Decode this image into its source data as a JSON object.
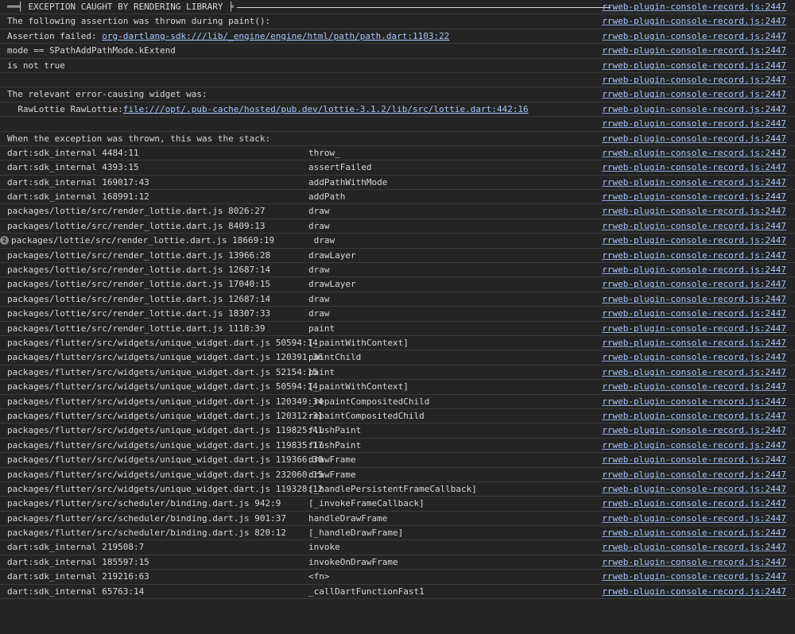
{
  "header_line": "══╡ EXCEPTION CAUGHT BY RENDERING LIBRARY ╞",
  "source_link": "rrweb-plugin-console-record.js:2447",
  "messages": {
    "thrown": "The following assertion was thrown during paint():",
    "assert_prefix": "Assertion failed: ",
    "assert_link": "org-dartlang-sdk:///lib/_engine/engine/html/path/path.dart:1103:22",
    "condition": "mode == SPathAddPathMode.kExtend",
    "not_true": "is not true",
    "widget_title": "The relevant error-causing widget was:",
    "widget_prefix": "  RawLottie RawLottie:",
    "widget_link": "file:///opt/.pub-cache/hosted/pub.dev/lottie-3.1.2/lib/src/lottie.dart:442:16",
    "stack_title": "When the exception was thrown, this was the stack:"
  },
  "repeat_badge": "2",
  "stack": [
    {
      "loc": "dart:sdk_internal 4484:11",
      "fn": "throw_"
    },
    {
      "loc": "dart:sdk_internal 4393:15",
      "fn": "assertFailed"
    },
    {
      "loc": "dart:sdk_internal 169017:43",
      "fn": "addPathWithMode"
    },
    {
      "loc": "dart:sdk_internal 168991:12",
      "fn": "addPath"
    },
    {
      "loc": "packages/lottie/src/render_lottie.dart.js 8026:27",
      "fn": "draw"
    },
    {
      "loc": "packages/lottie/src/render_lottie.dart.js 8409:13",
      "fn": "draw"
    },
    {
      "loc": "packages/lottie/src/render_lottie.dart.js 18669:19",
      "fn": " draw"
    },
    {
      "loc": "packages/lottie/src/render_lottie.dart.js 13966:28",
      "fn": "drawLayer"
    },
    {
      "loc": "packages/lottie/src/render_lottie.dart.js 12687:14",
      "fn": "draw"
    },
    {
      "loc": "packages/lottie/src/render_lottie.dart.js 17040:15",
      "fn": "drawLayer"
    },
    {
      "loc": "packages/lottie/src/render_lottie.dart.js 12687:14",
      "fn": "draw"
    },
    {
      "loc": "packages/lottie/src/render_lottie.dart.js 18307:33",
      "fn": "draw"
    },
    {
      "loc": "packages/lottie/src/render_lottie.dart.js 1118:39",
      "fn": "paint"
    },
    {
      "loc": "packages/flutter/src/widgets/unique_widget.dart.js 50594:14",
      "fn": "[_paintWithContext]"
    },
    {
      "loc": "packages/flutter/src/widgets/unique_widget.dart.js 120391:36",
      "fn": "paintChild"
    },
    {
      "loc": "packages/flutter/src/widgets/unique_widget.dart.js 52154:15",
      "fn": "paint"
    },
    {
      "loc": "packages/flutter/src/widgets/unique_widget.dart.js 50594:14",
      "fn": "[_paintWithContext]"
    },
    {
      "loc": "packages/flutter/src/widgets/unique_widget.dart.js 120349:34",
      "fn": "_repaintCompositedChild"
    },
    {
      "loc": "packages/flutter/src/widgets/unique_widget.dart.js 120312:31",
      "fn": "repaintCompositedChild"
    },
    {
      "loc": "packages/flutter/src/widgets/unique_widget.dart.js 119825:41",
      "fn": "flushPaint"
    },
    {
      "loc": "packages/flutter/src/widgets/unique_widget.dart.js 119835:17",
      "fn": "flushPaint"
    },
    {
      "loc": "packages/flutter/src/widgets/unique_widget.dart.js 119366:30",
      "fn": "drawFrame"
    },
    {
      "loc": "packages/flutter/src/widgets/unique_widget.dart.js 232060:15",
      "fn": "drawFrame"
    },
    {
      "loc": "packages/flutter/src/widgets/unique_widget.dart.js 119328:12",
      "fn": "[_handlePersistentFrameCallback]"
    },
    {
      "loc": "packages/flutter/src/scheduler/binding.dart.js 942:9",
      "fn": "[_invokeFrameCallback]"
    },
    {
      "loc": "packages/flutter/src/scheduler/binding.dart.js 901:37",
      "fn": "handleDrawFrame"
    },
    {
      "loc": "packages/flutter/src/scheduler/binding.dart.js 820:12",
      "fn": "[_handleDrawFrame]"
    },
    {
      "loc": "dart:sdk_internal 219508:7",
      "fn": "invoke"
    },
    {
      "loc": "dart:sdk_internal 185597:15",
      "fn": "invokeOnDrawFrame"
    },
    {
      "loc": "dart:sdk_internal 219216:63",
      "fn": "<fn>"
    },
    {
      "loc": "dart:sdk_internal 65763:14",
      "fn": "_callDartFunctionFast1"
    }
  ]
}
